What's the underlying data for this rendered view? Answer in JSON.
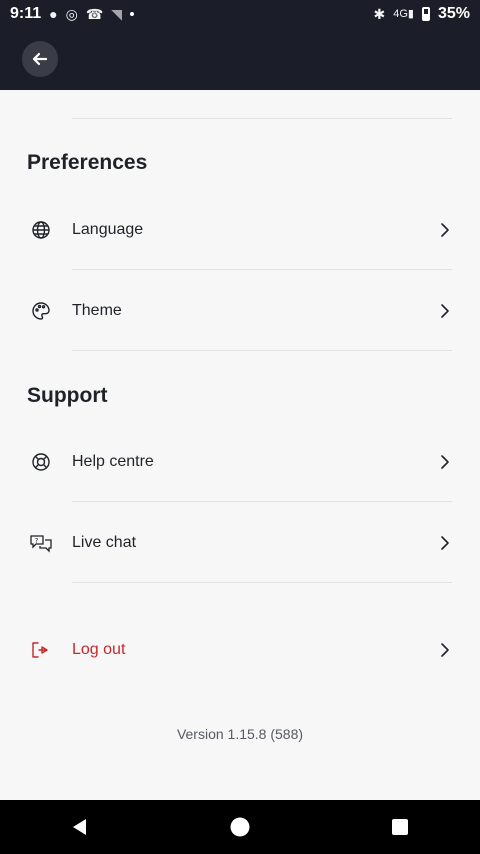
{
  "status": {
    "time": "9:11",
    "battery": "35%",
    "left_icons": [
      "message-icon",
      "whatsapp-icon",
      "missed-call-icon",
      "wifi-icon",
      "dot-icon"
    ],
    "right_icons": [
      "bluetooth-icon",
      "4g-signal-icon",
      "battery-icon"
    ],
    "network": "4G"
  },
  "app_bar": {
    "back_icon": "arrow-left-icon"
  },
  "sections": {
    "preferences": {
      "title": "Preferences",
      "items": [
        {
          "label": "Language",
          "icon": "globe-icon"
        },
        {
          "label": "Theme",
          "icon": "palette-icon"
        }
      ]
    },
    "support": {
      "title": "Support",
      "items": [
        {
          "label": "Help centre",
          "icon": "lifebuoy-icon"
        },
        {
          "label": "Live chat",
          "icon": "chat-icon"
        }
      ]
    }
  },
  "logout": {
    "label": "Log out",
    "icon": "logout-icon",
    "color": "#c6282b"
  },
  "version": "Version 1.15.8 (588)",
  "colors": {
    "app_bar_bg": "#1b1e28",
    "page_bg": "#f7f7f8",
    "text": "#1f2329",
    "danger": "#c6282b"
  }
}
